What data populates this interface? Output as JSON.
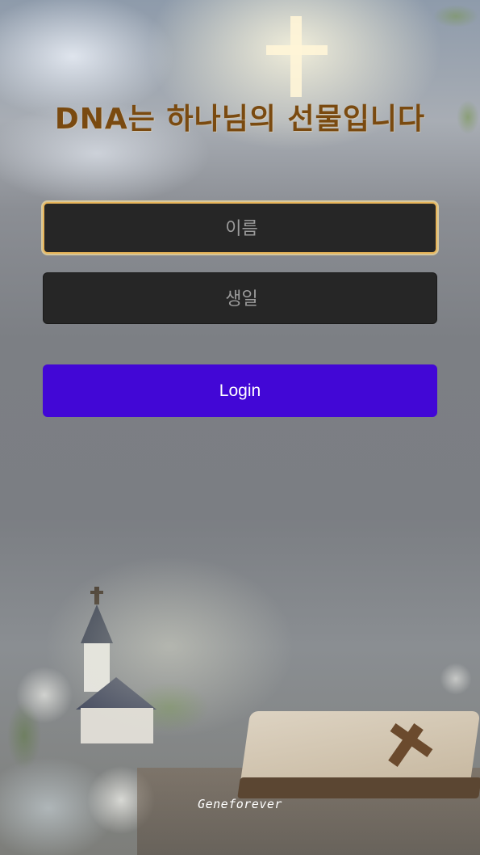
{
  "header": {
    "title": "DNA는 하나님의 선물입니다"
  },
  "form": {
    "name_placeholder": "이름",
    "name_value": "",
    "birthday_placeholder": "생일",
    "birthday_value": "",
    "login_label": "Login"
  },
  "footer": {
    "brand": "Geneforever"
  },
  "colors": {
    "title": "#7a4a10",
    "input_background": "#262626",
    "focus_border": "#e8b55a",
    "login_button": "#4207d6",
    "login_text": "#ffffff"
  },
  "icons": {
    "background_scene": "church-bible-cross-scene"
  }
}
